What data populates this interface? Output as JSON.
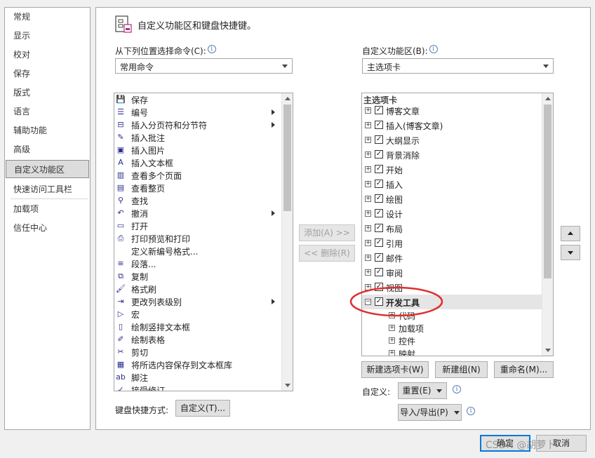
{
  "nav": {
    "items": [
      {
        "label": "常规"
      },
      {
        "label": "显示"
      },
      {
        "label": "校对"
      },
      {
        "label": "保存"
      },
      {
        "label": "版式"
      },
      {
        "label": "语言"
      },
      {
        "label": "辅助功能"
      },
      {
        "label": "高级"
      },
      {
        "label": "自定义功能区",
        "active": true
      },
      {
        "label": "快速访问工具栏"
      },
      {
        "label": "加载项"
      },
      {
        "label": "信任中心"
      }
    ]
  },
  "header": {
    "title": "自定义功能区和键盘快捷键。"
  },
  "left_panel": {
    "choose_label": "从下列位置选择命令(C):",
    "choose_value": "常用命令",
    "commands": [
      {
        "label": "保存",
        "icon": "save-icon",
        "glyph": "💾"
      },
      {
        "label": "编号",
        "icon": "numbering-icon",
        "glyph": "☰",
        "submenu": true
      },
      {
        "label": "插入分页符和分节符",
        "icon": "page-break-icon",
        "glyph": "⊟",
        "submenu": true
      },
      {
        "label": "插入批注",
        "icon": "comment-icon",
        "glyph": "✎"
      },
      {
        "label": "插入图片",
        "icon": "picture-icon",
        "glyph": "▣"
      },
      {
        "label": "插入文本框",
        "icon": "textbox-icon",
        "glyph": "A"
      },
      {
        "label": "查看多个页面",
        "icon": "multipage-icon",
        "glyph": "▥"
      },
      {
        "label": "查看整页",
        "icon": "onepage-icon",
        "glyph": "▤"
      },
      {
        "label": "查找",
        "icon": "find-icon",
        "glyph": "⚲"
      },
      {
        "label": "撤消",
        "icon": "undo-icon",
        "glyph": "↶",
        "submenu": true
      },
      {
        "label": "打开",
        "icon": "open-icon",
        "glyph": "▭"
      },
      {
        "label": "打印预览和打印",
        "icon": "print-icon",
        "glyph": "⎙"
      },
      {
        "label": "定义新编号格式...",
        "icon": "",
        "glyph": ""
      },
      {
        "label": "段落...",
        "icon": "paragraph-icon",
        "glyph": "≡"
      },
      {
        "label": "复制",
        "icon": "copy-icon",
        "glyph": "⧉"
      },
      {
        "label": "格式刷",
        "icon": "format-painter-icon",
        "glyph": "🖌"
      },
      {
        "label": "更改列表级别",
        "icon": "list-level-icon",
        "glyph": "⇥",
        "submenu": true
      },
      {
        "label": "宏",
        "icon": "macro-icon",
        "glyph": "▷"
      },
      {
        "label": "绘制竖排文本框",
        "icon": "vertical-textbox-icon",
        "glyph": "▯"
      },
      {
        "label": "绘制表格",
        "icon": "draw-table-icon",
        "glyph": "✐"
      },
      {
        "label": "剪切",
        "icon": "cut-icon",
        "glyph": "✂"
      },
      {
        "label": "将所选内容保存到文本框库",
        "icon": "save-selection-icon",
        "glyph": "▦"
      },
      {
        "label": "脚注",
        "icon": "footnote-icon",
        "glyph": "ab"
      },
      {
        "label": "接受修订",
        "icon": "accept-icon",
        "glyph": "✓"
      }
    ]
  },
  "middle": {
    "add_label": "添加(A) >>",
    "remove_label": "<< 删除(R)"
  },
  "right_panel": {
    "customize_label": "自定义功能区(B):",
    "customize_value": "主选项卡",
    "tree_header": "主选项卡",
    "tabs": [
      {
        "label": "博客文章",
        "checked": true
      },
      {
        "label": "插入(博客文章)",
        "checked": true
      },
      {
        "label": "大纲显示",
        "checked": true
      },
      {
        "label": "背景消除",
        "checked": true
      },
      {
        "label": "开始",
        "checked": true
      },
      {
        "label": "插入",
        "checked": true
      },
      {
        "label": "绘图",
        "checked": true
      },
      {
        "label": "设计",
        "checked": true
      },
      {
        "label": "布局",
        "checked": true
      },
      {
        "label": "引用",
        "checked": true
      },
      {
        "label": "邮件",
        "checked": true
      },
      {
        "label": "审阅",
        "checked": true
      },
      {
        "label": "视图",
        "checked": true
      },
      {
        "label": "开发工具",
        "checked": true,
        "expanded": true,
        "selected": true
      }
    ],
    "groups": [
      {
        "label": "代码"
      },
      {
        "label": "加载项"
      },
      {
        "label": "控件"
      },
      {
        "label": "映射"
      }
    ],
    "new_tab_label": "新建选项卡(W)",
    "new_group_label": "新建组(N)",
    "rename_label": "重命名(M)...",
    "customize_field_label": "自定义:",
    "reset_label": "重置(E)",
    "import_export_label": "导入/导出(P)"
  },
  "keyboard": {
    "label": "键盘快捷方式:",
    "button_label": "自定义(T)..."
  },
  "footer": {
    "ok_label": "确定",
    "cancel_label": "取消",
    "watermark": "CSDN @胡萝卜"
  },
  "colors": {
    "highlight_circle": "#e03030",
    "accent": "#0078d7"
  }
}
